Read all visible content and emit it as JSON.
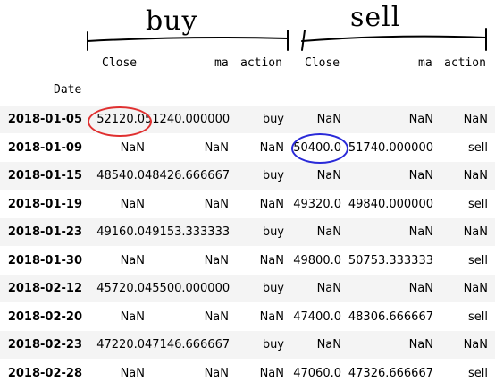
{
  "annotations": {
    "buy_label": "buy",
    "sell_label": "sell",
    "colors": {
      "red_circle": "#e03030",
      "blue_circle": "#2a2ad8"
    }
  },
  "columns": {
    "buy_close": "Close",
    "buy_ma": "ma",
    "buy_action": "action",
    "sell_close": "Close",
    "sell_ma": "ma",
    "sell_action": "action"
  },
  "index_name": "Date",
  "rows": [
    {
      "date": "2018-01-05",
      "buy_close": "52120.0",
      "buy_ma": "51240.000000",
      "buy_action": "buy",
      "sell_close": "NaN",
      "sell_ma": "NaN",
      "sell_action": "NaN"
    },
    {
      "date": "2018-01-09",
      "buy_close": "NaN",
      "buy_ma": "NaN",
      "buy_action": "NaN",
      "sell_close": "50400.0",
      "sell_ma": "51740.000000",
      "sell_action": "sell"
    },
    {
      "date": "2018-01-15",
      "buy_close": "48540.0",
      "buy_ma": "48426.666667",
      "buy_action": "buy",
      "sell_close": "NaN",
      "sell_ma": "NaN",
      "sell_action": "NaN"
    },
    {
      "date": "2018-01-19",
      "buy_close": "NaN",
      "buy_ma": "NaN",
      "buy_action": "NaN",
      "sell_close": "49320.0",
      "sell_ma": "49840.000000",
      "sell_action": "sell"
    },
    {
      "date": "2018-01-23",
      "buy_close": "49160.0",
      "buy_ma": "49153.333333",
      "buy_action": "buy",
      "sell_close": "NaN",
      "sell_ma": "NaN",
      "sell_action": "NaN"
    },
    {
      "date": "2018-01-30",
      "buy_close": "NaN",
      "buy_ma": "NaN",
      "buy_action": "NaN",
      "sell_close": "49800.0",
      "sell_ma": "50753.333333",
      "sell_action": "sell"
    },
    {
      "date": "2018-02-12",
      "buy_close": "45720.0",
      "buy_ma": "45500.000000",
      "buy_action": "buy",
      "sell_close": "NaN",
      "sell_ma": "NaN",
      "sell_action": "NaN"
    },
    {
      "date": "2018-02-20",
      "buy_close": "NaN",
      "buy_ma": "NaN",
      "buy_action": "NaN",
      "sell_close": "47400.0",
      "sell_ma": "48306.666667",
      "sell_action": "sell"
    },
    {
      "date": "2018-02-23",
      "buy_close": "47220.0",
      "buy_ma": "47146.666667",
      "buy_action": "buy",
      "sell_close": "NaN",
      "sell_ma": "NaN",
      "sell_action": "NaN"
    },
    {
      "date": "2018-02-28",
      "buy_close": "NaN",
      "buy_ma": "NaN",
      "buy_action": "NaN",
      "sell_close": "47060.0",
      "sell_ma": "47326.666667",
      "sell_action": "sell"
    }
  ]
}
